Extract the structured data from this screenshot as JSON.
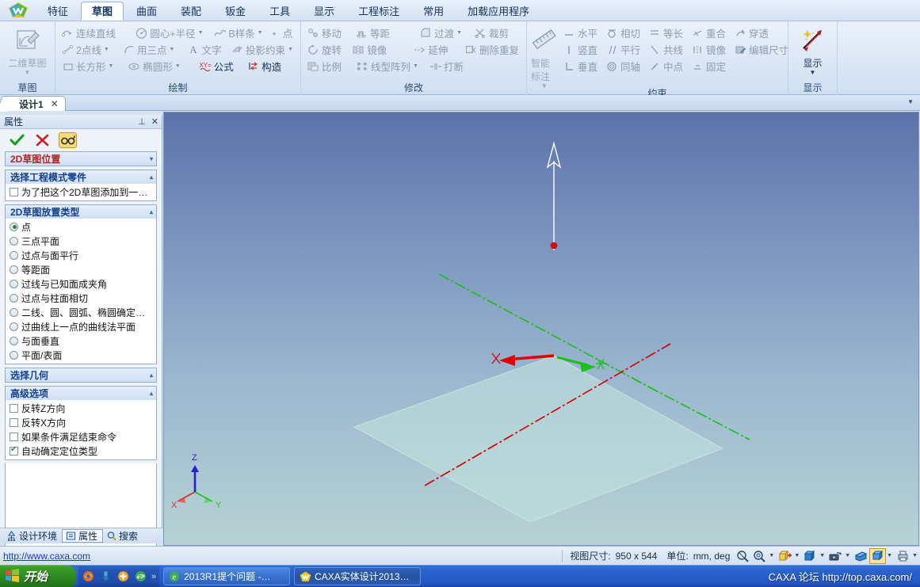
{
  "app": {
    "logo_icon": "caxa-logo-icon"
  },
  "ribbon": {
    "tabs": [
      {
        "label": "特征",
        "active": false
      },
      {
        "label": "草图",
        "active": true
      },
      {
        "label": "曲面",
        "active": false
      },
      {
        "label": "装配",
        "active": false
      },
      {
        "label": "钣金",
        "active": false
      },
      {
        "label": "工具",
        "active": false
      },
      {
        "label": "显示",
        "active": false
      },
      {
        "label": "工程标注",
        "active": false
      },
      {
        "label": "常用",
        "active": false
      },
      {
        "label": "加载应用程序",
        "active": false
      }
    ],
    "groups": [
      {
        "title": "草图",
        "big_button": {
          "label": "二维草图",
          "icon": "sketch2d-icon",
          "enabled": false
        }
      },
      {
        "title": "绘制",
        "items": [
          {
            "label": "连续直线",
            "icon": "polyline-icon",
            "dropdown": false,
            "enabled": false
          },
          {
            "label": "圆心+半径",
            "icon": "circle-center-radius-icon",
            "dropdown": true,
            "enabled": false
          },
          {
            "label": "B样条",
            "icon": "bspline-icon",
            "dropdown": true,
            "enabled": false
          },
          {
            "label": "点",
            "icon": "point-icon",
            "dropdown": false,
            "enabled": false
          },
          {
            "label": "2点线",
            "icon": "two-point-line-icon",
            "dropdown": true,
            "enabled": false
          },
          {
            "label": "用三点",
            "icon": "three-point-arc-icon",
            "dropdown": true,
            "enabled": false
          },
          {
            "label": "文字",
            "icon": "text-icon",
            "dropdown": false,
            "enabled": false
          },
          {
            "label": "投影约束",
            "icon": "projection-constraint-icon",
            "dropdown": true,
            "enabled": false
          },
          {
            "label": "长方形",
            "icon": "rectangle-icon",
            "dropdown": true,
            "enabled": false
          },
          {
            "label": "椭圆形",
            "icon": "ellipse-icon",
            "dropdown": true,
            "enabled": false
          },
          {
            "label": "公式",
            "icon": "formula-icon",
            "dropdown": false,
            "enabled": false
          },
          {
            "label": "构造",
            "icon": "construction-icon",
            "dropdown": false,
            "enabled": false
          }
        ]
      },
      {
        "title": "修改",
        "items": [
          {
            "label": "移动",
            "icon": "move-icon",
            "dropdown": false,
            "enabled": false
          },
          {
            "label": "等距",
            "icon": "offset-icon",
            "dropdown": false,
            "enabled": false
          },
          {
            "label": "过渡",
            "icon": "fillet-icon",
            "dropdown": true,
            "enabled": false
          },
          {
            "label": "裁剪",
            "icon": "trim-icon",
            "dropdown": false,
            "enabled": false
          },
          {
            "label": "旋转",
            "icon": "rotate-icon",
            "dropdown": false,
            "enabled": false
          },
          {
            "label": "镜像",
            "icon": "mirror-icon",
            "dropdown": false,
            "enabled": false
          },
          {
            "label": "延伸",
            "icon": "extend-icon",
            "dropdown": false,
            "enabled": false
          },
          {
            "label": "删除重复",
            "icon": "delete-duplicate-icon",
            "dropdown": false,
            "enabled": false
          },
          {
            "label": "比例",
            "icon": "scale-icon",
            "dropdown": false,
            "enabled": false
          },
          {
            "label": "线型阵列",
            "icon": "linear-pattern-icon",
            "dropdown": true,
            "enabled": false
          },
          {
            "label": "打断",
            "icon": "break-icon",
            "dropdown": false,
            "enabled": false
          }
        ]
      },
      {
        "title": "约束",
        "big_button": {
          "label": "智能标注",
          "icon": "smart-dimension-icon",
          "enabled": false
        },
        "items": [
          {
            "label": "水平",
            "icon": "horizontal-icon",
            "dropdown": false,
            "enabled": false
          },
          {
            "label": "相切",
            "icon": "tangent-icon",
            "dropdown": false,
            "enabled": false
          },
          {
            "label": "等长",
            "icon": "equal-length-icon",
            "dropdown": false,
            "enabled": false
          },
          {
            "label": "重合",
            "icon": "coincident-icon",
            "dropdown": false,
            "enabled": false
          },
          {
            "label": "穿透",
            "icon": "pierce-icon",
            "dropdown": false,
            "enabled": false
          },
          {
            "label": "竖直",
            "icon": "vertical-icon",
            "dropdown": false,
            "enabled": false
          },
          {
            "label": "平行",
            "icon": "parallel-icon",
            "dropdown": false,
            "enabled": false
          },
          {
            "label": "共线",
            "icon": "collinear-icon",
            "dropdown": false,
            "enabled": false
          },
          {
            "label": "镜像",
            "icon": "mirror-constraint-icon",
            "dropdown": false,
            "enabled": false
          },
          {
            "label": "编辑尺寸",
            "icon": "edit-dimension-icon",
            "dropdown": false,
            "enabled": false
          },
          {
            "label": "垂直",
            "icon": "perpendicular-icon",
            "dropdown": false,
            "enabled": false
          },
          {
            "label": "同轴",
            "icon": "concentric-icon",
            "dropdown": false,
            "enabled": false
          },
          {
            "label": "中点",
            "icon": "midpoint-icon",
            "dropdown": false,
            "enabled": false
          },
          {
            "label": "固定",
            "icon": "fix-icon",
            "dropdown": false,
            "enabled": false
          }
        ]
      },
      {
        "title": "显示",
        "big_button": {
          "label": "显示",
          "icon": "display-icon",
          "enabled": true
        }
      }
    ]
  },
  "document": {
    "tab_label": "设计1",
    "close_label": "✕"
  },
  "panel": {
    "title": "属性",
    "pin_icon": "pin-icon",
    "close_icon": "close-icon",
    "commands": [
      {
        "name": "confirm",
        "icon": "check-icon",
        "highlight": false
      },
      {
        "name": "cancel",
        "icon": "x-icon",
        "highlight": false
      },
      {
        "name": "preview",
        "icon": "glasses-icon",
        "highlight": true
      }
    ],
    "sections": [
      {
        "id": "position",
        "title": "2D草图位置",
        "color": "red",
        "arrow": "▾",
        "collapsed": true
      },
      {
        "id": "engineering_part",
        "title": "选择工程模式零件",
        "color": "blue",
        "arrow": "▴",
        "checkboxes": [
          {
            "label": "为了把这个2D草图添加到一…",
            "checked": false
          }
        ]
      },
      {
        "id": "placement_type",
        "title": "2D草图放置类型",
        "color": "blue",
        "arrow": "▴",
        "radios": [
          {
            "label": "点",
            "checked": true
          },
          {
            "label": "三点平面",
            "checked": false
          },
          {
            "label": "过点与面平行",
            "checked": false
          },
          {
            "label": "等距面",
            "checked": false
          },
          {
            "label": "过线与已知面成夹角",
            "checked": false
          },
          {
            "label": "过点与柱面相切",
            "checked": false
          },
          {
            "label": "二线、圆、圆弧、椭圆确定…",
            "checked": false
          },
          {
            "label": "过曲线上一点的曲线法平面",
            "checked": false
          },
          {
            "label": "与面垂直",
            "checked": false
          },
          {
            "label": "平面/表面",
            "checked": false
          }
        ]
      },
      {
        "id": "select_geometry",
        "title": "选择几何",
        "color": "blue",
        "arrow": "▴"
      },
      {
        "id": "advanced",
        "title": "高级选项",
        "color": "blue",
        "arrow": "▴",
        "checkboxes": [
          {
            "label": "反转Z方向",
            "checked": false
          },
          {
            "label": "反转X方向",
            "checked": false
          },
          {
            "label": "如果条件满足结束命令",
            "checked": false
          },
          {
            "label": "自动确定定位类型",
            "checked": true
          }
        ]
      }
    ],
    "bottom_tabs": [
      {
        "label": "设计环境",
        "icon": "design-tree-icon",
        "selected": false
      },
      {
        "label": "属性",
        "icon": "properties-icon",
        "selected": true
      },
      {
        "label": "搜索",
        "icon": "search-icon",
        "selected": false
      }
    ]
  },
  "viewport": {
    "triad": {
      "x_label": "X",
      "y_label": "Y",
      "z_label": "Z",
      "x_color": "#d92b2b",
      "y_color": "#19c219",
      "z_color": "#2222cc"
    },
    "plane_color": "#bfe0dd",
    "axis_x_color": "#d40000",
    "axis_y_color": "#12c412",
    "normal_arrow_color": "#ffffff",
    "origin_point_color": "#cc1111"
  },
  "statusbar": {
    "url": "http://www.caxa.com",
    "view_size_label": "视图尺寸:",
    "view_size_value": "950 x  544",
    "units_label": "单位:",
    "units_value": "mm, deg",
    "tools": [
      {
        "name": "zoom-window-icon",
        "dropdown": false,
        "highlight": false
      },
      {
        "name": "zoom-all-icon",
        "dropdown": true,
        "highlight": false
      },
      {
        "name": "view-orientation-icon",
        "dropdown": true,
        "highlight": false
      },
      {
        "name": "shaded-view-icon",
        "dropdown": true,
        "highlight": false
      },
      {
        "name": "camera-icon",
        "dropdown": true,
        "highlight": false
      },
      {
        "name": "perspective-icon",
        "dropdown": false,
        "highlight": false
      },
      {
        "name": "render-mode-icon",
        "dropdown": true,
        "highlight": true
      },
      {
        "name": "print-icon",
        "dropdown": true,
        "highlight": false
      }
    ]
  },
  "taskbar": {
    "start_label": "开始",
    "start_icon": "windows-flag-icon",
    "quick_launch": [
      {
        "icon": "firefox-icon"
      },
      {
        "icon": "download-icon"
      },
      {
        "icon": "plus-browser-icon"
      },
      {
        "icon": "ie-icon"
      }
    ],
    "quick_chevron": "»",
    "windows": [
      {
        "label": "2013R1提个问题 -…",
        "icon": "ie-icon",
        "active": false
      },
      {
        "label": "CAXA实体设计2013…",
        "icon": "caxa-logo-icon",
        "active": true
      }
    ],
    "watermark": "CAXA 论坛 http://top.caxa.com/"
  }
}
